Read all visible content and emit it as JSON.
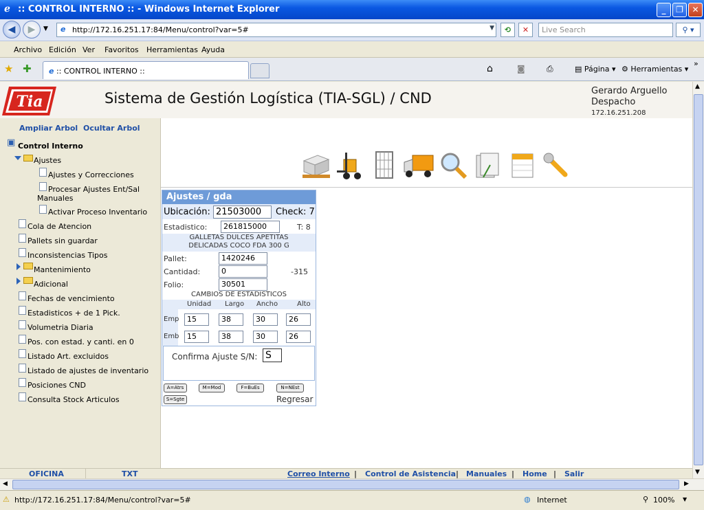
{
  "window": {
    "title": ":: CONTROL INTERNO :: - Windows Internet Explorer"
  },
  "address_bar": {
    "url": "http://172.16.251.17:84/Menu/control?var=5#",
    "search_placeholder": "Live Search"
  },
  "menu": [
    "Archivo",
    "Edición",
    "Ver",
    "Favoritos",
    "Herramientas",
    "Ayuda"
  ],
  "tab": {
    "title": ":: CONTROL INTERNO ::"
  },
  "command_bar": {
    "page": "Página",
    "tools": "Herramientas"
  },
  "header": {
    "logo_text": "Tia",
    "title": "Sistema de Gestión Logística (TIA-SGL) / CND",
    "user_name": "Gerardo Arguello",
    "user_role": "Despacho",
    "user_ip": "172.16.251.208"
  },
  "sidebar": {
    "expand_tree": "Ampliar Arbol",
    "hide_tree": "Ocultar Arbol",
    "root": "Control Interno",
    "folder_ajustes": "Ajustes",
    "ajustes_items": [
      "Ajustes y Correcciones",
      "Procesar Ajustes Ent/Sal",
      "Manuales",
      "Activar Proceso Inventario"
    ],
    "items_a": [
      "Cola de Atencion",
      "Pallets sin guardar",
      "Inconsistencias Tipos"
    ],
    "folder_mantenimiento": "Mantenimiento",
    "folder_adicional": "Adicional",
    "items_b": [
      "Fechas de vencimiento",
      "Estadisticos + de 1 Pick.",
      "Volumetria Diaria",
      "Pos. con estad. y canti. en 0",
      "Listado Art. excluidos",
      "Listado de ajustes de inventario",
      "Posiciones CND",
      "Consulta Stock Articulos"
    ]
  },
  "form": {
    "title": "Ajustes / gda",
    "ubicacion_label": "Ubicación:",
    "ubicacion_value": "21503000",
    "check_label": "Check: 7",
    "estadistico_label": "Estadistico:",
    "estadistico_value": "261815000",
    "t_label": "T: 8",
    "product_line1": "GALLETAS DULCES APETITAS",
    "product_line2": "DELICADAS COCO FDA 300 G",
    "pallet_label": "Pallet:",
    "pallet_value": "1420246",
    "cantidad_label": "Cantidad:",
    "cantidad_value": "0",
    "cantidad_diff": "-315",
    "folio_label": "Folio:",
    "folio_value": "30501",
    "cambios_title": "CAMBIOS DE ESTADISTICOS",
    "columns": [
      "Unidad",
      "Largo",
      "Ancho",
      "Alto"
    ],
    "emp_label": "Emp",
    "emp_values": [
      "15",
      "38",
      "30",
      "26"
    ],
    "emb_label": "Emb",
    "emb_values": [
      "15",
      "38",
      "30",
      "26"
    ],
    "confirm_label": "Confirma Ajuste S/N:",
    "confirm_value": "S",
    "keys": [
      "A=Atrs",
      "M=Mod",
      "F=BuEs",
      "N=NEst",
      "S=Sgte"
    ],
    "back": "Regresar"
  },
  "footer": {
    "left": [
      "OFICINA",
      "TXT"
    ],
    "links": [
      "Correo Interno",
      "Control de Asistencia",
      "Manuales",
      "Home",
      "Salir"
    ],
    "sep": "|"
  },
  "status_bar": {
    "url": "http://172.16.251.17:84/Menu/control?var=5#",
    "zone": "Internet",
    "zoom": "100%"
  },
  "colors": {
    "accent": "#1f4fa6",
    "form_header": "#6e9bd8",
    "logo_red": "#d7261e"
  }
}
